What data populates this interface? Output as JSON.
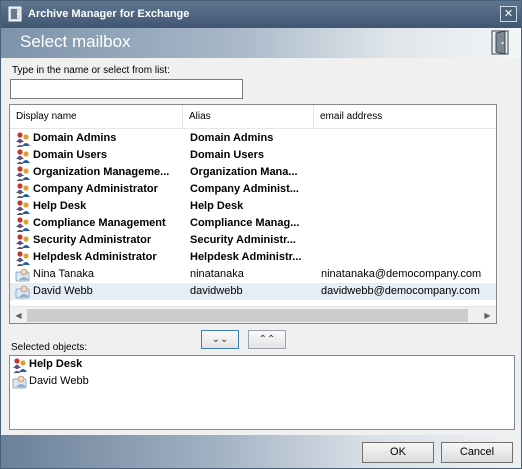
{
  "window": {
    "title": "Archive Manager for Exchange",
    "close_glyph": "✕"
  },
  "header": {
    "heading": "Select mailbox",
    "icon": "door-icon"
  },
  "search": {
    "prompt": "Type in the name or select from list:",
    "value": ""
  },
  "grid": {
    "columns": [
      "Display name",
      "Alias",
      "email address"
    ],
    "rows": [
      {
        "name": "Domain Admins",
        "alias": "Domain Admins",
        "email": "",
        "type": "group"
      },
      {
        "name": "Domain Users",
        "alias": "Domain Users",
        "email": "",
        "type": "group"
      },
      {
        "name": "Organization Manageme...",
        "alias": "Organization Mana...",
        "email": "",
        "type": "group"
      },
      {
        "name": "Company Administrator",
        "alias": "Company Administ...",
        "email": "",
        "type": "group"
      },
      {
        "name": "Help Desk",
        "alias": "Help Desk",
        "email": "",
        "type": "group"
      },
      {
        "name": "Compliance Management",
        "alias": "Compliance Manag...",
        "email": "",
        "type": "group"
      },
      {
        "name": "Security Administrator",
        "alias": "Security Administr...",
        "email": "",
        "type": "group"
      },
      {
        "name": "Helpdesk Administrator",
        "alias": "Helpdesk Administr...",
        "email": "",
        "type": "group"
      },
      {
        "name": "Nina Tanaka",
        "alias": "ninatanaka",
        "email": "ninatanaka@democompany.com",
        "type": "user"
      },
      {
        "name": "David Webb",
        "alias": "davidwebb",
        "email": "davidwebb@democompany.com",
        "type": "user",
        "selected": true
      }
    ]
  },
  "move_buttons": {
    "add_glyph": "⌄⌄",
    "remove_glyph": "⌃⌃"
  },
  "selected": {
    "label": "Selected objects:",
    "items": [
      {
        "name": "Help Desk",
        "type": "group"
      },
      {
        "name": "David Webb",
        "type": "user"
      }
    ]
  },
  "footer": {
    "ok_label": "OK",
    "cancel_label": "Cancel"
  },
  "colors": {
    "titlebar": "#4a6078",
    "selected_row": "#e5edf5",
    "accent_border": "#3c7fb1"
  }
}
